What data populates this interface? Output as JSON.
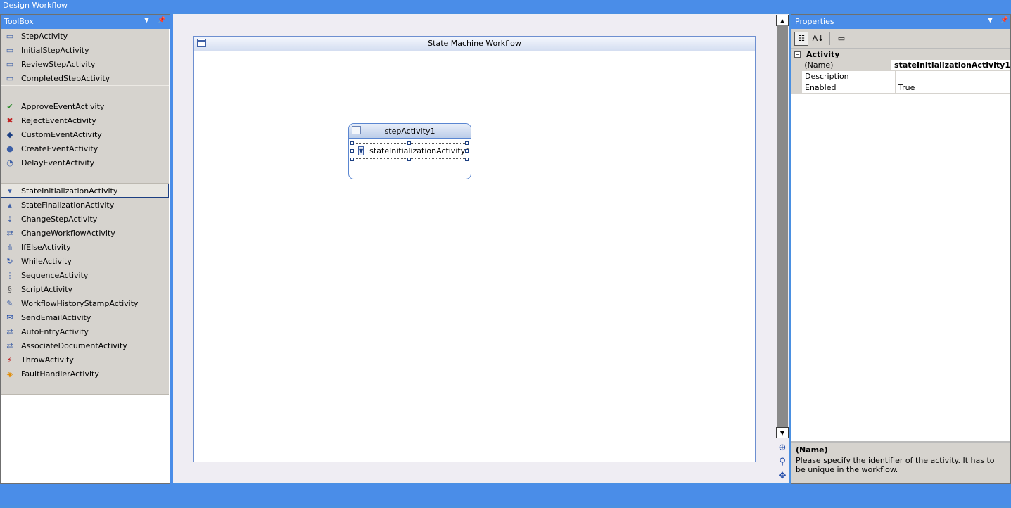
{
  "window": {
    "title": "Design Workflow"
  },
  "toolbox": {
    "title": "ToolBox",
    "dropdown_icon": "chevron-down-icon",
    "pin_icon": "pin-icon",
    "groups": [
      [
        {
          "label": "StepActivity",
          "icon": "step-icon"
        },
        {
          "label": "InitialStepActivity",
          "icon": "step-icon"
        },
        {
          "label": "ReviewStepActivity",
          "icon": "review-step-icon"
        },
        {
          "label": "CompletedStepActivity",
          "icon": "step-icon"
        }
      ],
      [
        {
          "label": "ApproveEventActivity",
          "icon": "approve-event-icon"
        },
        {
          "label": "RejectEventActivity",
          "icon": "reject-event-icon"
        },
        {
          "label": "CustomEventActivity",
          "icon": "custom-event-icon"
        },
        {
          "label": "CreateEventActivity",
          "icon": "create-event-icon"
        },
        {
          "label": "DelayEventActivity",
          "icon": "delay-event-icon"
        }
      ],
      [
        {
          "label": "StateInitializationActivity",
          "icon": "state-init-icon",
          "selected": true
        },
        {
          "label": "StateFinalizationActivity",
          "icon": "state-final-icon"
        },
        {
          "label": "ChangeStepActivity",
          "icon": "change-step-icon"
        },
        {
          "label": "ChangeWorkflowActivity",
          "icon": "change-workflow-icon"
        },
        {
          "label": "IfElseActivity",
          "icon": "ifelse-icon"
        },
        {
          "label": "WhileActivity",
          "icon": "while-icon"
        },
        {
          "label": "SequenceActivity",
          "icon": "sequence-icon"
        },
        {
          "label": "ScriptActivity",
          "icon": "script-icon"
        },
        {
          "label": "WorkflowHistoryStampActivity",
          "icon": "history-stamp-icon"
        },
        {
          "label": "SendEmailActivity",
          "icon": "send-email-icon"
        },
        {
          "label": "AutoEntryActivity",
          "icon": "auto-entry-icon"
        },
        {
          "label": "AssociateDocumentActivity",
          "icon": "associate-document-icon"
        },
        {
          "label": "ThrowActivity",
          "icon": "throw-icon"
        },
        {
          "label": "FaultHandlerActivity",
          "icon": "fault-handler-icon"
        }
      ]
    ]
  },
  "designer": {
    "workflow_title": "State Machine Workflow",
    "state_title": "stepActivity1",
    "child_activity": "stateInitializationActivity1"
  },
  "scrollbar": {
    "tools": [
      "zoom-icon",
      "find-icon",
      "pan-icon"
    ]
  },
  "properties": {
    "title": "Properties",
    "category": "Activity",
    "rows": [
      {
        "name": "(Name)",
        "value": "stateInitializationActivity1",
        "bold": true
      },
      {
        "name": "Description",
        "value": ""
      },
      {
        "name": "Enabled",
        "value": "True"
      }
    ],
    "help_title": "(Name)",
    "help_text": "Please specify the identifier of the activity. It has to be unique in the workflow."
  },
  "colors": {
    "accent": "#4a8de8",
    "panel_gray": "#d6d3ce",
    "workflow_border": "#6d8fd0"
  }
}
